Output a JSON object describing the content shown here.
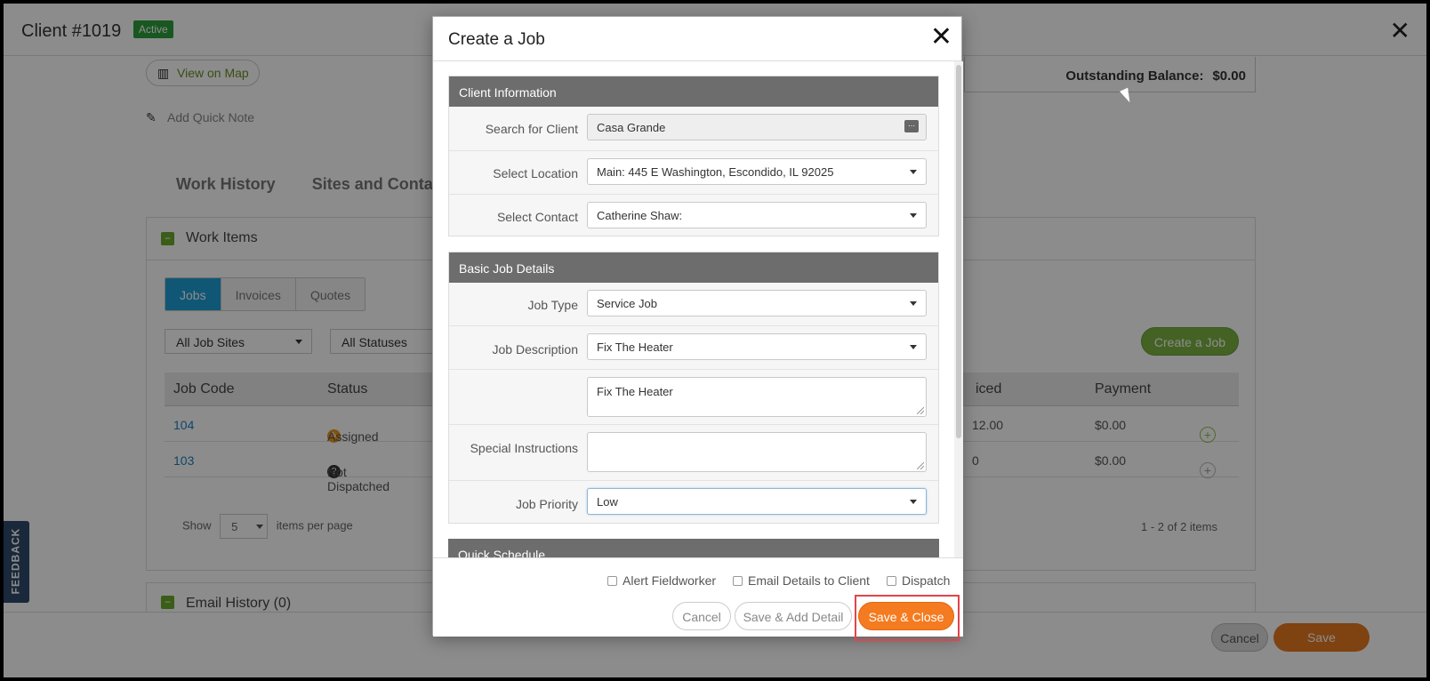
{
  "page": {
    "client_title": "Client #1019",
    "status_badge": "Active",
    "view_on_map": "View on Map",
    "add_quick_note": "Add Quick Note",
    "outstanding_label": "Outstanding Balance:",
    "outstanding_value": "$0.00",
    "tabs": [
      "Work History",
      "Sites and Contacts"
    ],
    "work_items_title": "Work Items",
    "segment": [
      "Jobs",
      "Invoices",
      "Quotes"
    ],
    "filter_sites": "All Job Sites",
    "filter_statuses": "All Statuses",
    "create_job_button": "Create a Job",
    "table_headers": {
      "job_code": "Job Code",
      "status": "Status",
      "invoiced": "iced",
      "payment": "Payment"
    },
    "rows": [
      {
        "code": "104",
        "status": "Assigned",
        "invoiced": "12.00",
        "payment": "$0.00"
      },
      {
        "code": "103",
        "status": "Not Dispatched",
        "invoiced": "0",
        "payment": "$0.00"
      }
    ],
    "pager": {
      "show": "Show",
      "per_page_value": "5",
      "per_page_label": "items per page",
      "summary": "1 - 2 of 2 items"
    },
    "email_history": "Email History (0)",
    "feedback": "FEEDBACK",
    "footer_cancel": "Cancel",
    "footer_save": "Save"
  },
  "modal": {
    "title": "Create a Job",
    "client_info": {
      "heading": "Client Information",
      "search_label": "Search for Client",
      "search_value": "Casa Grande",
      "location_label": "Select Location",
      "location_value": "Main: 445 E Washington, Escondido, IL 92025",
      "contact_label": "Select Contact",
      "contact_value": "Catherine Shaw:"
    },
    "job_details": {
      "heading": "Basic Job Details",
      "type_label": "Job Type",
      "type_value": "Service Job",
      "desc_label": "Job Description",
      "desc_value": "Fix The Heater",
      "desc_text": "Fix The Heater",
      "instructions_label": "Special Instructions",
      "instructions_value": "",
      "priority_label": "Job Priority",
      "priority_value": "Low"
    },
    "quick_schedule_heading": "Quick Schedule",
    "checkboxes": {
      "alert": "Alert Fieldworker",
      "email": "Email Details to Client",
      "dispatch": "Dispatch"
    },
    "buttons": {
      "cancel": "Cancel",
      "save_add": "Save & Add Detail",
      "save_close": "Save & Close"
    }
  },
  "colors": {
    "accent_orange": "#f47b20",
    "active_green": "#2e9e3c",
    "tab_blue": "#1e9fd6",
    "highlight_red": "#e0454a"
  }
}
